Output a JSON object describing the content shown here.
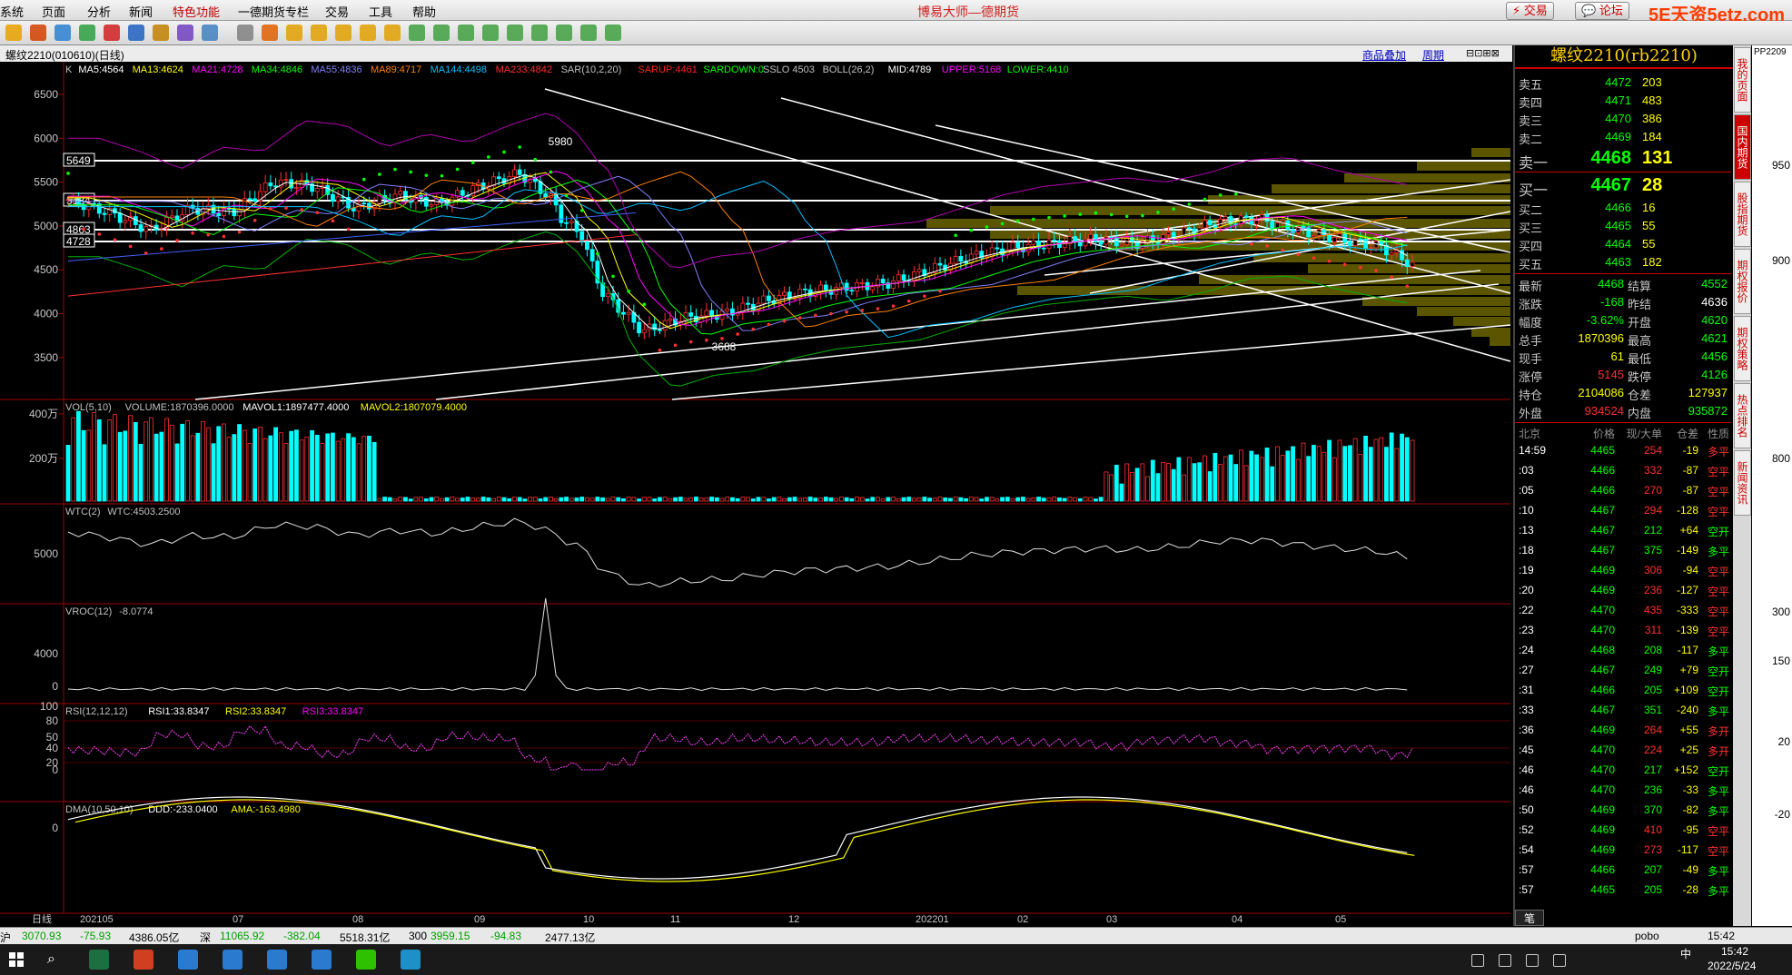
{
  "app": {
    "title": "博易大师—德期货",
    "brand": "5E天资5etz.com",
    "menu": [
      "系统",
      "页面",
      "分析",
      "新闻",
      "特色功能",
      "一德期货专栏",
      "交易",
      "工具",
      "帮助"
    ],
    "buttons": {
      "trade": "交易",
      "forum": "论坛"
    }
  },
  "toolbar": {
    "icons": [
      "home-icon",
      "back-icon",
      "forward-icon",
      "refresh-icon",
      "search-icon",
      "zoom-icon",
      "pin-icon",
      "draw-icon",
      "list-icon",
      "grid-icon",
      "tick-icon",
      "day-icon",
      "month-icon",
      "week-icon",
      "quarter-icon",
      "cross-icon",
      "1-icon",
      "3-icon",
      "5-icon",
      "15-icon",
      "30-icon",
      "60-icon",
      "2h-icon",
      "4h-icon",
      "year-icon"
    ]
  },
  "tabbar": {
    "symbol": "螺纹2210(010610)(日线)",
    "overlay": "商品叠加",
    "period": "周期"
  },
  "chart": {
    "main_indicators": [
      {
        "t": "K",
        "c": "#c0c0c0"
      },
      {
        "t": "MA5:4564",
        "c": "#ffffff"
      },
      {
        "t": "MA13:4624",
        "c": "#ffff00"
      },
      {
        "t": "MA21:4728",
        "c": "#ff00ff"
      },
      {
        "t": "MA34:4846",
        "c": "#00ff00"
      },
      {
        "t": "MA55:4836",
        "c": "#8080ff"
      },
      {
        "t": "MA89:4717",
        "c": "#ff8000"
      },
      {
        "t": "MA144:4498",
        "c": "#00c0ff"
      },
      {
        "t": "MA233:4842",
        "c": "#ff3030"
      },
      {
        "t": "SAR(10,2,20)",
        "c": "#c0c0c0"
      },
      {
        "t": "SARUP:4461",
        "c": "#ff2020"
      },
      {
        "t": "SARDOWN:0",
        "c": "#00ff00"
      },
      {
        "t": "SSLO 4503",
        "c": "#c0c0c0"
      },
      {
        "t": "BOLL(26,2)",
        "c": "#c0c0c0"
      },
      {
        "t": "MID:4789",
        "c": "#ffffff"
      },
      {
        "t": "UPPER:5168",
        "c": "#ff00ff"
      },
      {
        "t": "LOWER:4410",
        "c": "#00ff00"
      }
    ],
    "price_ticks": [
      "6500",
      "6000",
      "5500",
      "5000",
      "4500",
      "4000",
      "3500"
    ],
    "level_labels": [
      "5649",
      "5184",
      "4863",
      "4728"
    ],
    "peak_label": "5980",
    "trough_label": "3688",
    "vol_header": [
      {
        "t": "VOL(5,10)",
        "c": "#c0c0c0"
      },
      {
        "t": "VOLUME:1870396.0000",
        "c": "#c0c0c0"
      },
      {
        "t": "MAVOL1:1897477.4000",
        "c": "#ffffff"
      },
      {
        "t": "MAVOL2:1807079.4000",
        "c": "#ffff00"
      }
    ],
    "vol_ticks": [
      "400万",
      "200万"
    ],
    "wtc_header": [
      {
        "t": "WTC(2)",
        "c": "#c0c0c0"
      },
      {
        "t": "WTC:4503.2500",
        "c": "#c0c0c0"
      }
    ],
    "wtc_ticks": [
      "5000"
    ],
    "vroc_header": [
      {
        "t": "VROC(12)",
        "c": "#c0c0c0"
      },
      {
        "t": "-8.0774",
        "c": "#c0c0c0"
      }
    ],
    "vroc_ticks": [
      "4000",
      "0"
    ],
    "rsi_header": [
      {
        "t": "RSI(12,12,12)",
        "c": "#c0c0c0"
      },
      {
        "t": "RSI1:33.8347",
        "c": "#ffffff"
      },
      {
        "t": "RSI2:33.8347",
        "c": "#ffff00"
      },
      {
        "t": "RSI3:33.8347",
        "c": "#ff00ff"
      }
    ],
    "rsi_ticks": [
      "100",
      "80",
      "50",
      "40",
      "20",
      "0"
    ],
    "dma_header": [
      {
        "t": "DMA(10,50,10)",
        "c": "#c0c0c0"
      },
      {
        "t": "DDD:-233.0400",
        "c": "#ffffff"
      },
      {
        "t": "AMA:-163.4980",
        "c": "#ffff00"
      }
    ],
    "dma_ticks": [
      "0"
    ],
    "x_labels": [
      "日线",
      "202105",
      "07",
      "08",
      "09",
      "10",
      "11",
      "12",
      "202201",
      "02",
      "03",
      "04",
      "05"
    ]
  },
  "quote": {
    "title": "螺纹2210(rb2210)",
    "asks": [
      {
        "label": "卖五",
        "price": "4472",
        "vol": "203"
      },
      {
        "label": "卖四",
        "price": "4471",
        "vol": "483"
      },
      {
        "label": "卖三",
        "price": "4470",
        "vol": "386"
      },
      {
        "label": "卖二",
        "price": "4469",
        "vol": "184"
      },
      {
        "label": "卖一",
        "price": "4468",
        "vol": "131"
      }
    ],
    "bids": [
      {
        "label": "买一",
        "price": "4467",
        "vol": "28"
      },
      {
        "label": "买二",
        "price": "4466",
        "vol": "16"
      },
      {
        "label": "买三",
        "price": "4465",
        "vol": "55"
      },
      {
        "label": "买四",
        "price": "4464",
        "vol": "55"
      },
      {
        "label": "买五",
        "price": "4463",
        "vol": "182"
      }
    ],
    "stats": [
      {
        "l1": "最新",
        "v1": "4468",
        "c1": "#00ff00",
        "l2": "结算",
        "v2": "4552",
        "c2": "#00ff00"
      },
      {
        "l1": "涨跌",
        "v1": "-168",
        "c1": "#00ff00",
        "l2": "昨结",
        "v2": "4636",
        "c2": "#ffffff"
      },
      {
        "l1": "幅度",
        "v1": "-3.62%",
        "c1": "#00ff00",
        "l2": "开盘",
        "v2": "4620",
        "c2": "#00ff00"
      },
      {
        "l1": "总手",
        "v1": "1870396",
        "c1": "#ffff00",
        "l2": "最高",
        "v2": "4621",
        "c2": "#00ff00"
      },
      {
        "l1": "现手",
        "v1": "61",
        "c1": "#ffff00",
        "l2": "最低",
        "v2": "4456",
        "c2": "#00ff00"
      },
      {
        "l1": "涨停",
        "v1": "5145",
        "c1": "#ff3030",
        "l2": "跌停",
        "v2": "4126",
        "c2": "#00ff00"
      },
      {
        "l1": "持仓",
        "v1": "2104086",
        "c1": "#ffff00",
        "l2": "仓差",
        "v2": "127937",
        "c2": "#ffff00"
      },
      {
        "l1": "外盘",
        "v1": "934524",
        "c1": "#ff3030",
        "l2": "内盘",
        "v2": "935872",
        "c2": "#00ff00"
      }
    ],
    "tick_header": {
      "time": "北京",
      "price": "价格",
      "vol": "现/大单",
      "oi": "仓差",
      "nature": "性质"
    },
    "ticks": [
      {
        "time": "14:59",
        "price": "4465",
        "vol": "254",
        "oi": "-19",
        "nature": "多平",
        "nc": "#ff3030"
      },
      {
        "time": ":03",
        "price": "4466",
        "vol": "332",
        "oi": "-87",
        "nature": "空平",
        "nc": "#ff3030"
      },
      {
        "time": ":05",
        "price": "4466",
        "vol": "270",
        "oi": "-87",
        "nature": "空平",
        "nc": "#ff3030"
      },
      {
        "time": ":10",
        "price": "4467",
        "vol": "294",
        "oi": "-128",
        "nature": "空平",
        "nc": "#ff3030"
      },
      {
        "time": ":13",
        "price": "4467",
        "vol": "212",
        "oi": "+64",
        "nature": "空开",
        "nc": "#00ff00"
      },
      {
        "time": ":18",
        "price": "4467",
        "vol": "375",
        "oi": "-149",
        "nature": "多平",
        "nc": "#00ff00"
      },
      {
        "time": ":19",
        "price": "4469",
        "vol": "306",
        "oi": "-94",
        "nature": "空平",
        "nc": "#ff3030"
      },
      {
        "time": ":20",
        "price": "4469",
        "vol": "236",
        "oi": "-127",
        "nature": "空平",
        "nc": "#ff3030"
      },
      {
        "time": ":22",
        "price": "4470",
        "vol": "435",
        "oi": "-333",
        "nature": "空平",
        "nc": "#ff3030"
      },
      {
        "time": ":23",
        "price": "4470",
        "vol": "311",
        "oi": "-139",
        "nature": "空平",
        "nc": "#ff3030"
      },
      {
        "time": ":24",
        "price": "4468",
        "vol": "208",
        "oi": "-117",
        "nature": "多平",
        "nc": "#00ff00"
      },
      {
        "time": ":27",
        "price": "4467",
        "vol": "249",
        "oi": "+79",
        "nature": "空开",
        "nc": "#00ff00"
      },
      {
        "time": ":31",
        "price": "4466",
        "vol": "205",
        "oi": "+109",
        "nature": "空开",
        "nc": "#00ff00"
      },
      {
        "time": ":33",
        "price": "4467",
        "vol": "351",
        "oi": "-240",
        "nature": "多平",
        "nc": "#00ff00"
      },
      {
        "time": ":36",
        "price": "4469",
        "vol": "264",
        "oi": "+55",
        "nature": "多开",
        "nc": "#ff3030"
      },
      {
        "time": ":45",
        "price": "4470",
        "vol": "224",
        "oi": "+25",
        "nature": "多开",
        "nc": "#ff3030"
      },
      {
        "time": ":46",
        "price": "4470",
        "vol": "217",
        "oi": "+152",
        "nature": "空开",
        "nc": "#00ff00"
      },
      {
        "time": ":46",
        "price": "4470",
        "vol": "236",
        "oi": "-33",
        "nature": "多平",
        "nc": "#00ff00"
      },
      {
        "time": ":50",
        "price": "4469",
        "vol": "370",
        "oi": "-82",
        "nature": "多平",
        "nc": "#00ff00"
      },
      {
        "time": ":52",
        "price": "4469",
        "vol": "410",
        "oi": "-95",
        "nature": "空平",
        "nc": "#ff3030"
      },
      {
        "time": ":54",
        "price": "4469",
        "vol": "273",
        "oi": "-117",
        "nature": "空平",
        "nc": "#ff3030"
      },
      {
        "time": ":57",
        "price": "4466",
        "vol": "207",
        "oi": "-49",
        "nature": "多平",
        "nc": "#00ff00"
      },
      {
        "time": ":57",
        "price": "4465",
        "vol": "205",
        "oi": "-28",
        "nature": "多平",
        "nc": "#00ff00"
      }
    ],
    "footer_tab": "笔"
  },
  "side_tabs": [
    "我的页面",
    "国内期货",
    "股指期货",
    "期权报价",
    "期权策略",
    "热点排名",
    "新闻资讯"
  ],
  "peek": {
    "code": "PP2209",
    "ticks": [
      "950",
      "900",
      "800",
      "300",
      "150",
      "20",
      "-20"
    ]
  },
  "status_bar": [
    {
      "t": "沪",
      "c": "#000"
    },
    {
      "t": "3070.93",
      "c": "#00a000"
    },
    {
      "t": "-75.93",
      "c": "#00a000"
    },
    {
      "t": "4386.05亿",
      "c": "#000"
    },
    {
      "t": "深",
      "c": "#000"
    },
    {
      "t": "11065.92",
      "c": "#00a000"
    },
    {
      "t": "-382.04",
      "c": "#00a000"
    },
    {
      "t": "5518.31亿",
      "c": "#000"
    },
    {
      "t": "300",
      "c": "#000"
    },
    {
      "t": "3959.15",
      "c": "#00a000"
    },
    {
      "t": "-94.83",
      "c": "#00a000"
    },
    {
      "t": "2477.13亿",
      "c": "#000"
    },
    {
      "t": "pobo",
      "c": "#000"
    },
    {
      "t": "15:42",
      "c": "#000"
    }
  ],
  "taskbar": {
    "time": "15:42",
    "date": "2022/5/24",
    "ime": "中"
  }
}
